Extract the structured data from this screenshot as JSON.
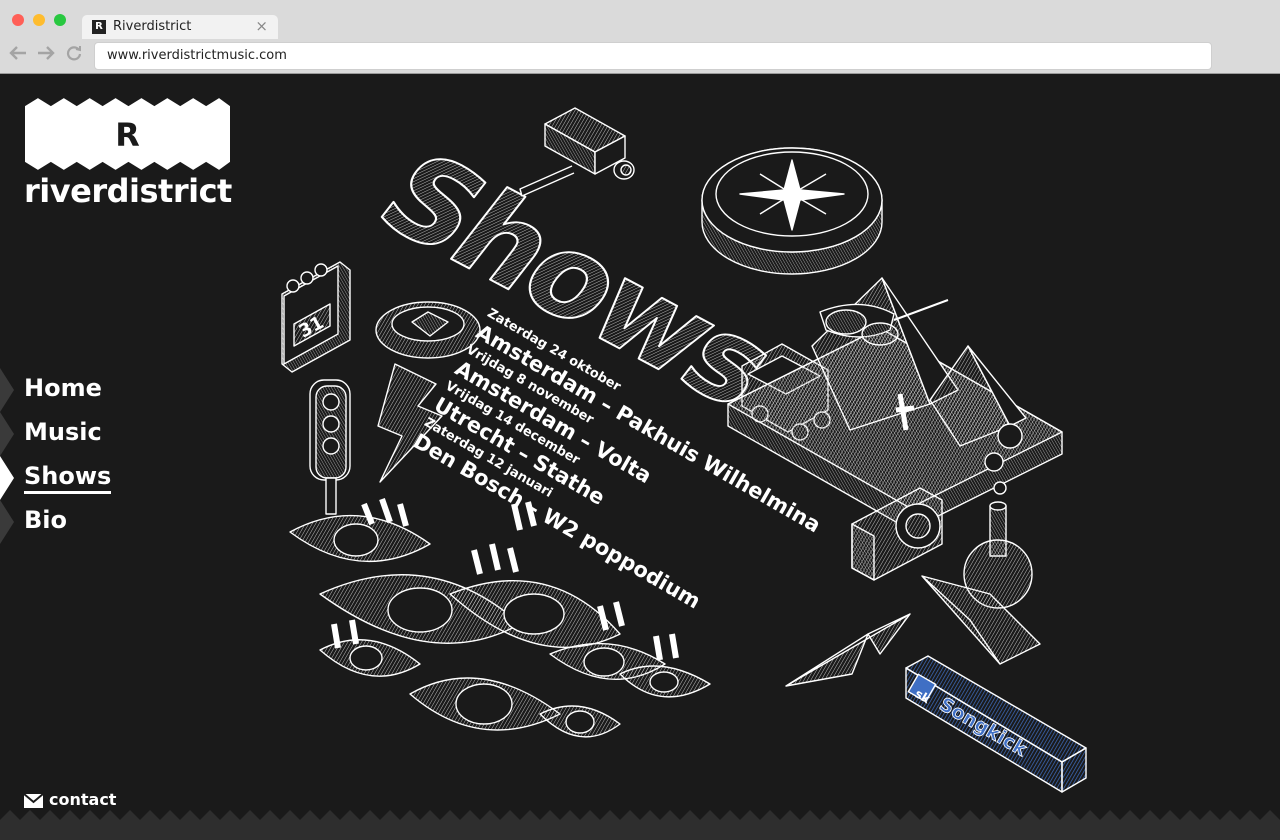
{
  "browser": {
    "tab_title": "Riverdistrict",
    "tab_icon": "R",
    "tab_close": "×",
    "url": "www.riverdistrictmusic.com",
    "colors": {
      "close": "#ff5f57",
      "minimize": "#febc2e",
      "zoom": "#28c840"
    }
  },
  "site": {
    "logo_letter": "R",
    "logo_word": "riverdistrict",
    "menu": [
      {
        "label": "Home",
        "active": false
      },
      {
        "label": "Music",
        "active": false
      },
      {
        "label": "Shows",
        "active": true
      },
      {
        "label": "Bio",
        "active": false
      }
    ],
    "contact_label": "contact",
    "art_title": "Shows",
    "calendar_day": "31",
    "songkick": {
      "badge": "sk",
      "label": "Songkick"
    }
  },
  "shows": [
    {
      "date": "Zaterdag 24 oktober",
      "venue": "Amsterdam – Pakhuis Wilhelmina"
    },
    {
      "date": "Vrijdag 8 november",
      "venue": "Amsterdam – Volta"
    },
    {
      "date": "Vrijdag 14 december",
      "venue": "Utrecht – Stathe"
    },
    {
      "date": "Zaterdag 12 januari",
      "venue": "Den Bosch – W2 poppodium"
    }
  ],
  "colors": {
    "background": "#1a1a1a",
    "foreground": "#ffffff",
    "songkick": "#3f6fc4"
  }
}
